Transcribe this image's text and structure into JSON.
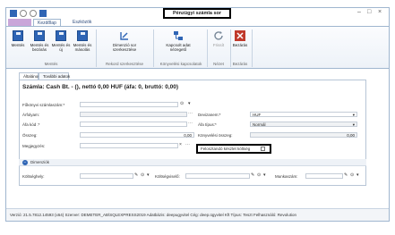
{
  "window": {
    "title": "Pénzügyi számla sor"
  },
  "tabs": [
    "Kezdőlap",
    "Eszközök"
  ],
  "ribbon": {
    "buttons": [
      {
        "label": "Mentés"
      },
      {
        "label": "Mentés és bezárás"
      },
      {
        "label": "Mentés és új"
      },
      {
        "label": "Mentés és másolás"
      },
      {
        "label": "Dimenzió sor szerkesztése"
      },
      {
        "label": "Kapcsolt adat nézegető"
      },
      {
        "label": "Frissít"
      },
      {
        "label": "Bezárás"
      }
    ],
    "groups": [
      "Mentés",
      "Rekord szerkesztése",
      "Könyvelési kapcsolatok",
      "Nézet",
      "Bezárás"
    ]
  },
  "doc_tabs": [
    "Általános",
    "További adatok"
  ],
  "heading": "Számla: Cash Bt. - (), nettó 0,00 HUF (áfa: 0, bruttó: 0,00)",
  "form": {
    "fokonyvi_label": "Főkönyvi számlaszám:*",
    "arfolyam_label": "Árfolyam:",
    "afa_kod_label": "Áfa kód :*",
    "osszeg_label": "Összeg:",
    "osszeg_value": "0,00",
    "megjegyzes_label": "Megjegyzés:",
    "devizanem_label": "Devizanem:*",
    "devizanem_value": "HUF",
    "afa_tipus_label": "Áfa típus:*",
    "afa_tipus_value": "Normál",
    "konyvelesi_osszeg_label": "Könyvelési összeg:",
    "konyvelesi_osszeg_value": "0,00",
    "felosztando_label": "Felosztandó készlet költség"
  },
  "dimensions": {
    "title": "Dimenziók",
    "koltseghely_label": "Költséghely:",
    "koltsegviselo_label": "Költségviselő:",
    "munkaszam_label": "Munkaszám:"
  },
  "status": "Verzió: 21.5.7812.14593 (x64)   Szerver: DEMETER_AB\\SQLEXPRESS2019   Adatbázis: deepugyvitel   Cég: deep.ügyvitel Kft   Típus: Teszt   Felhasználó: Revolution",
  "colors": {
    "accent": "#2f65b5",
    "close_red": "#c0392b",
    "file_tab": "#c9a6d9"
  }
}
